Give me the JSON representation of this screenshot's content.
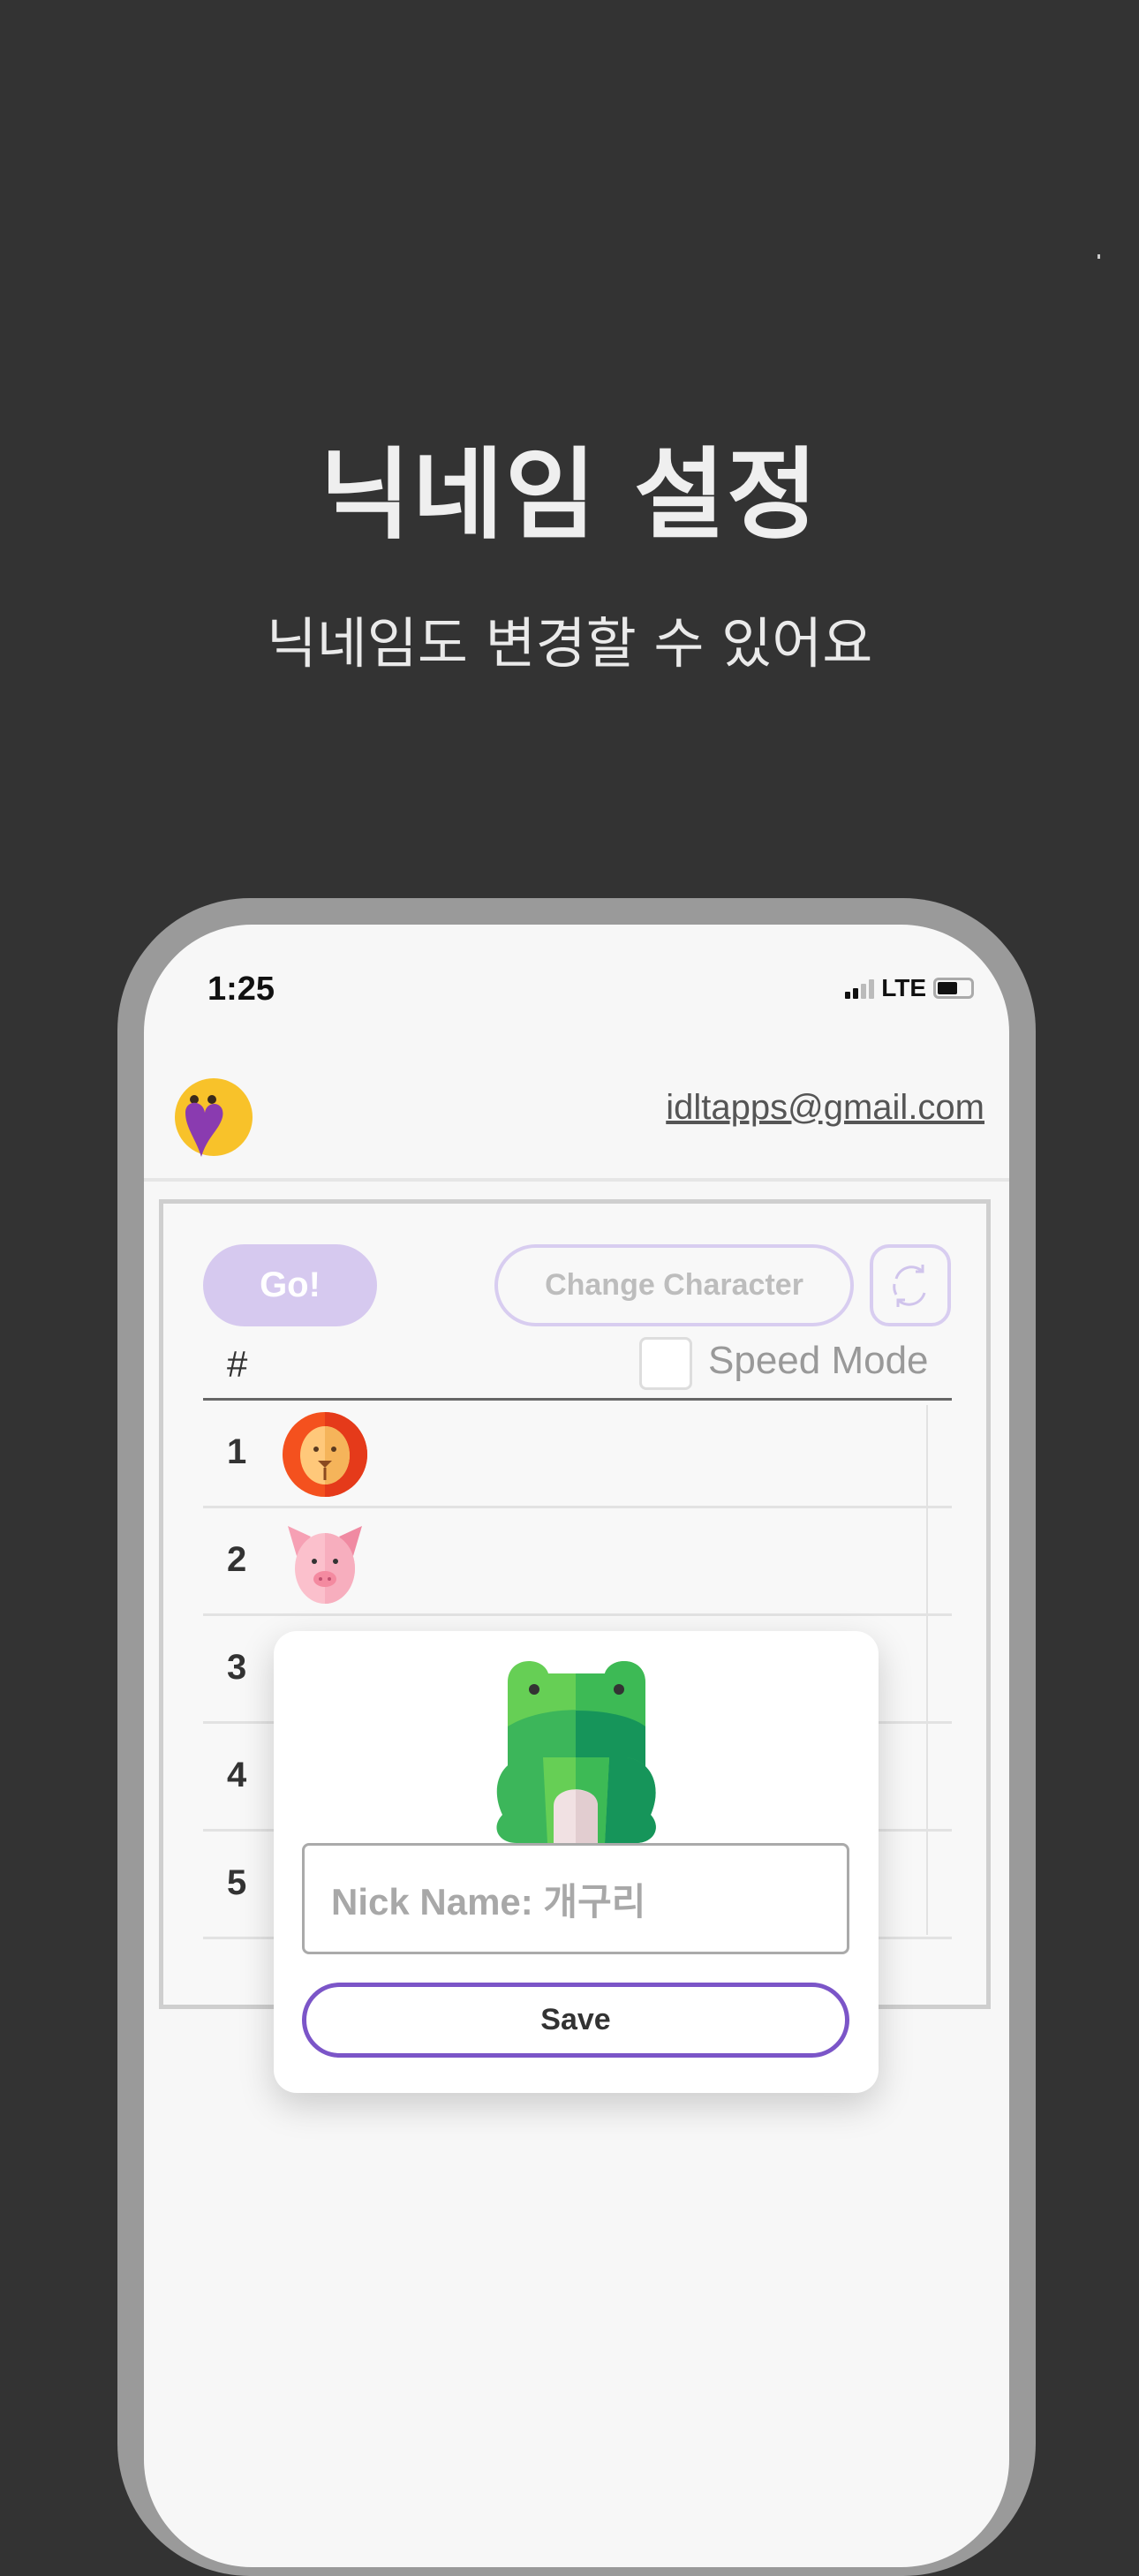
{
  "promo": {
    "title": "닉네임 설정",
    "subtitle": "닉네임도 변경할 수 있어요"
  },
  "status_bar": {
    "time": "1:25",
    "network": "LTE"
  },
  "header": {
    "email": "idltapps@gmail.com",
    "avatar_icon": "hugging-heart-face-icon"
  },
  "toolbar": {
    "go_label": "Go!",
    "change_character_label": "Change Character",
    "refresh_icon": "refresh-icon"
  },
  "table": {
    "header_hash": "#",
    "speed_mode_label": "Speed Mode",
    "speed_mode_checked": false,
    "rows": [
      {
        "rank": "1",
        "animal": "lion"
      },
      {
        "rank": "2",
        "animal": "pig"
      },
      {
        "rank": "3",
        "animal": ""
      },
      {
        "rank": "4",
        "animal": ""
      },
      {
        "rank": "5",
        "animal": ""
      }
    ]
  },
  "modal": {
    "character": "frog",
    "nickname_value": "Nick Name: 개구리",
    "save_label": "Save"
  },
  "colors": {
    "background": "#333333",
    "accent": "#7b55c8",
    "accent_light": "#d6c9ef"
  }
}
